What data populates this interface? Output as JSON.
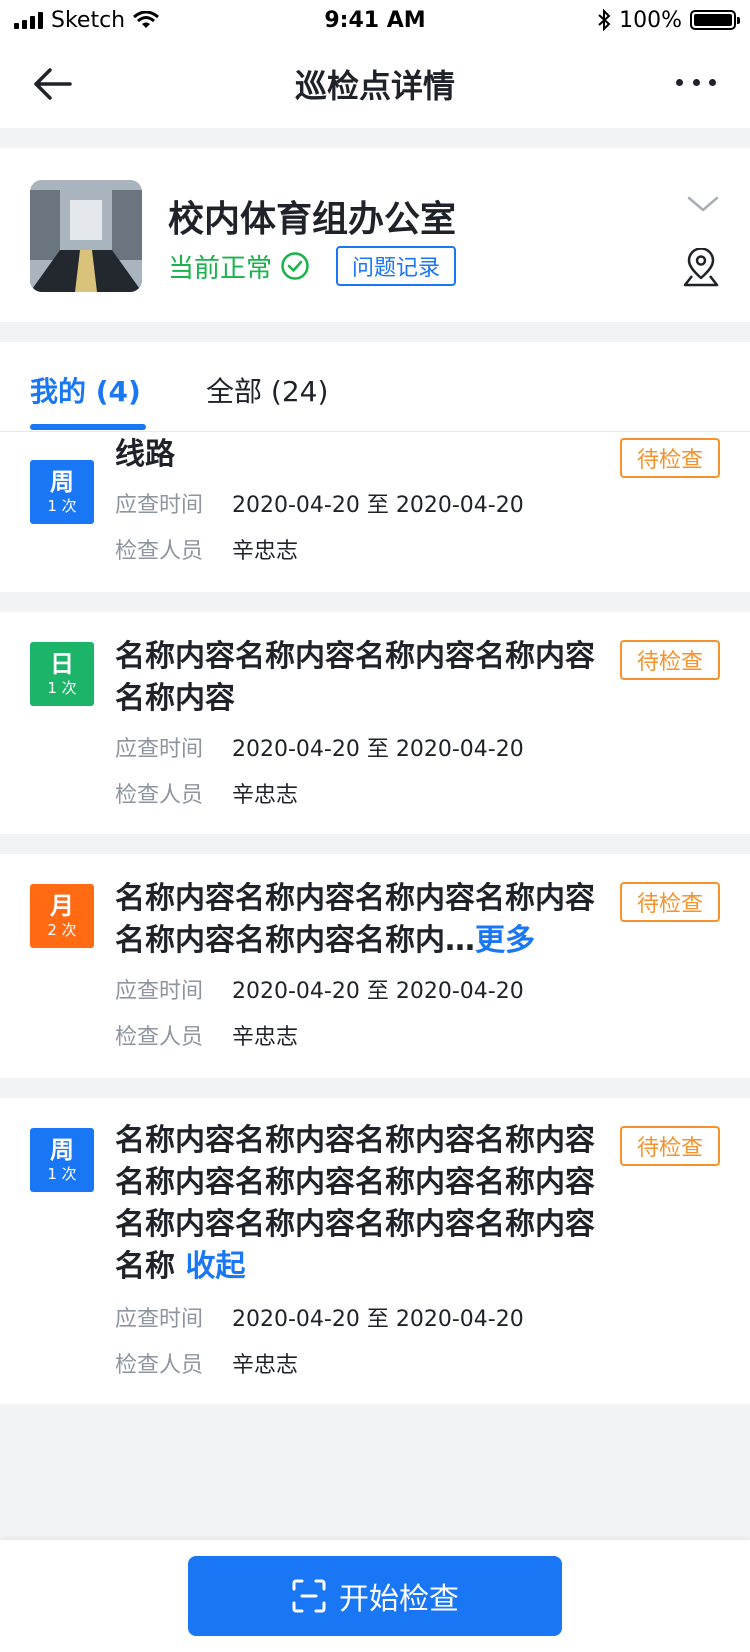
{
  "status_bar": {
    "carrier": "Sketch",
    "time": "9:41 AM",
    "battery": "100%"
  },
  "nav": {
    "title": "巡检点详情",
    "back_icon": "arrow-left-icon",
    "more_icon": "more-horizontal-icon"
  },
  "location": {
    "name": "校内体育组办公室",
    "status": "当前正常",
    "issue_button": "问题记录",
    "status_icon": "check-circle-icon",
    "expand_icon": "chevron-down-icon",
    "map_icon": "map-pin-icon"
  },
  "tabs": [
    {
      "label": "我的 (4)",
      "active": true
    },
    {
      "label": "全部 (24)",
      "active": false
    }
  ],
  "items": [
    {
      "freq": "周",
      "count": "1 次",
      "color": "#1976f5",
      "title": "线路",
      "title_link": "",
      "status": "待检查",
      "time_label": "应查时间",
      "time_value": "2020-04-20 至 2020-04-20",
      "person_label": "检查人员",
      "person_value": "辛忠志"
    },
    {
      "freq": "日",
      "count": "1 次",
      "color": "#1cb468",
      "title": "名称内容名称内容名称内容名称内容名称内容",
      "title_link": "",
      "status": "待检查",
      "time_label": "应查时间",
      "time_value": "2020-04-20 至 2020-04-20",
      "person_label": "检查人员",
      "person_value": "辛忠志"
    },
    {
      "freq": "月",
      "count": "2 次",
      "color": "#ff6a13",
      "title": "名称内容名称内容名称内容名称内容名称内容名称内容名称内…",
      "title_link": "更多",
      "status": "待检查",
      "time_label": "应查时间",
      "time_value": "2020-04-20 至 2020-04-20",
      "person_label": "检查人员",
      "person_value": "辛忠志"
    },
    {
      "freq": "周",
      "count": "1 次",
      "color": "#1976f5",
      "title": "名称内容名称内容名称内容名称内容名称内容名称内容名称内容名称内容名称内容名称内容名称内容名称内容名称 ",
      "title_link": "收起",
      "status": "待检查",
      "time_label": "应查时间",
      "time_value": "2020-04-20 至 2020-04-20",
      "person_label": "检查人员",
      "person_value": "辛忠志"
    }
  ],
  "bottom": {
    "start_button": "开始检查",
    "scan_icon": "scan-icon"
  }
}
